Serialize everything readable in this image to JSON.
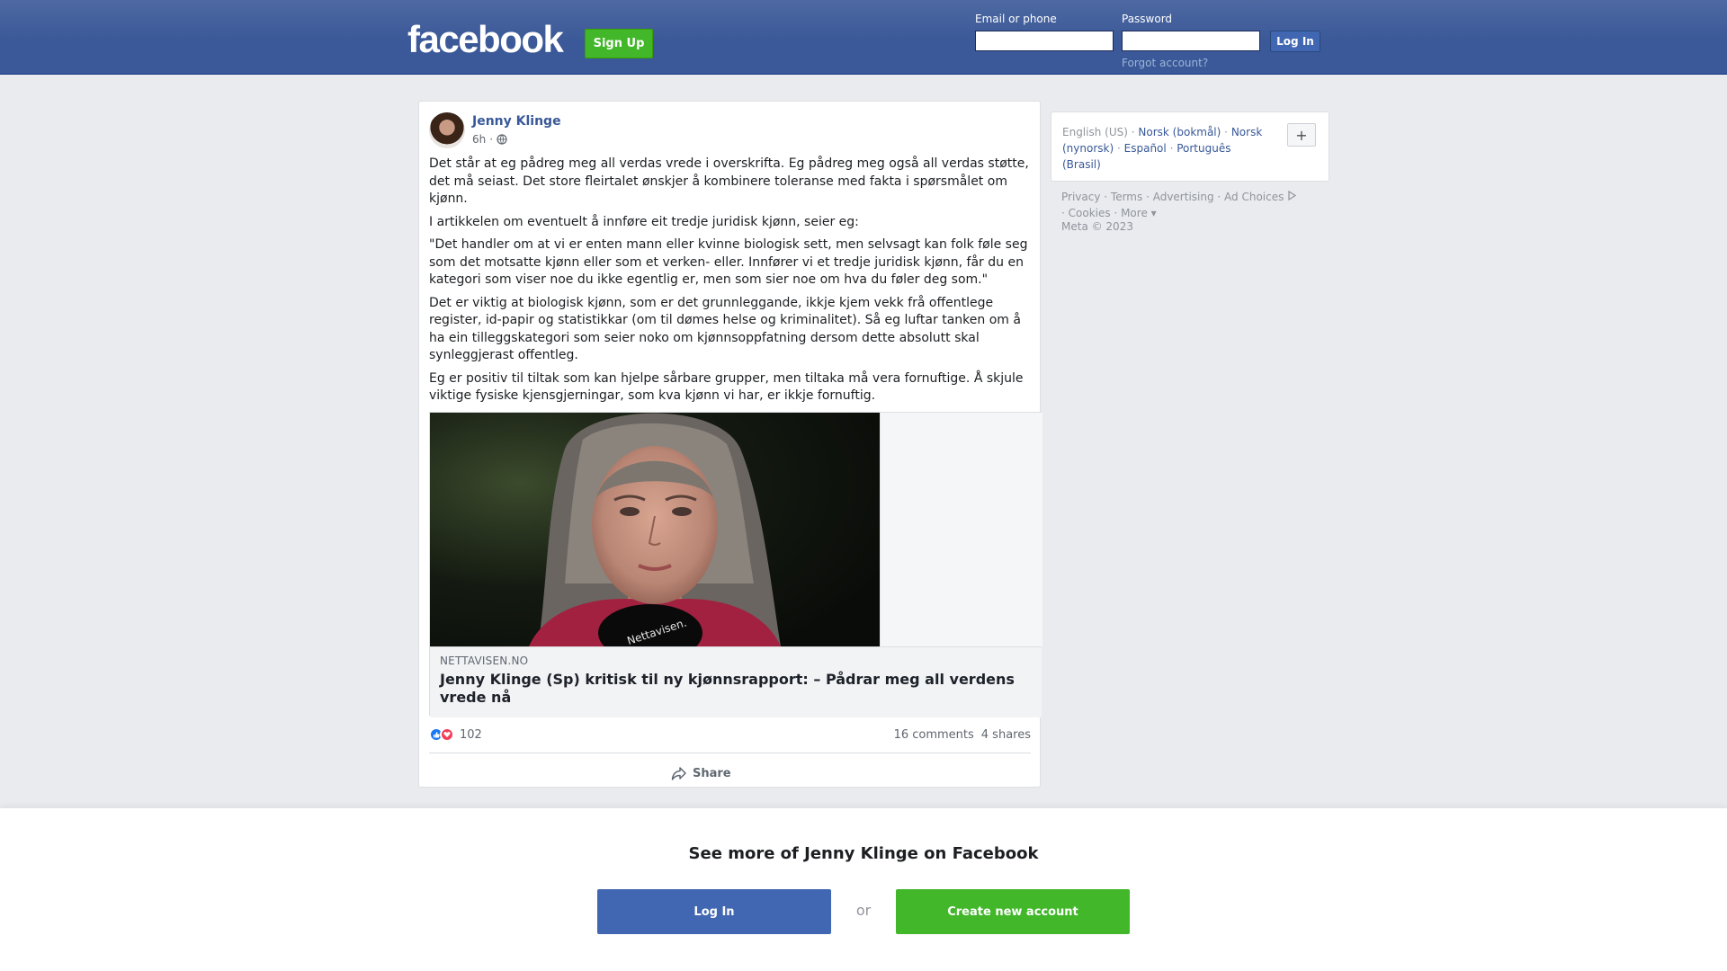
{
  "header": {
    "logo": "facebook",
    "signup_label": "Sign Up",
    "email_label": "Email or phone",
    "email_value": "",
    "password_label": "Password",
    "password_value": "",
    "login_label": "Log In",
    "forgot_label": "Forgot account?"
  },
  "post": {
    "author": "Jenny Klinge",
    "time": "6h",
    "time_separator": "·",
    "paragraphs": [
      "Det står at eg pådreg meg all verdas vrede i overskrifta. Eg pådreg meg også all verdas støtte, det må seiast. Det store fleirtalet ønskjer å kombinere toleranse med fakta i spørsmålet om kjønn.",
      "I artikkelen om eventuelt å innføre eit tredje juridisk kjønn, seier eg:",
      "\"Det handler om at vi er enten mann eller kvinne biologisk sett, men selvsagt kan folk føle seg som det motsatte kjønn eller som et verken- eller. Innfører vi et tredje juridisk kjønn, får du en kategori som viser noe du ikke egentlig er, men som sier noe om hva du føler deg som.\"",
      "Det er viktig at biologisk kjønn, som er det grunnleggande, ikkje kjem vekk frå offentlege register, id-papir og statistikkar (om til dømes helse og kriminalitet). Så eg luftar tanken om å ha ein tilleggskategori som seier noko om kjønnsoppfatning dersom dette absolutt skal synleggjerast offentleg.",
      "Eg er positiv til tiltak som kan hjelpe sårbare grupper, men tiltaka må vera fornuftige. Å skjule viktige fysiske kjensgjerningar, som kva kjønn vi har, er ikkje fornuftig."
    ],
    "link": {
      "source": "NETTAVISEN.NO",
      "headline": "Jenny Klinge (Sp) kritisk til ny kjønnsrapport: – Pådrar meg all verdens vrede nå",
      "mic_text": "Nettavisen."
    },
    "reactions_count": "102",
    "comments": "16 comments",
    "shares": "4 shares",
    "share_label": "Share"
  },
  "sidebar": {
    "languages": {
      "current": "English (US)",
      "others": [
        "Norsk (bokmål)",
        "Norsk (nynorsk)",
        "Español",
        "Português (Brasil)"
      ],
      "separator": "·"
    },
    "plus_label": "+",
    "footer_links": [
      "Privacy",
      "Terms",
      "Advertising",
      "Ad Choices",
      "Cookies",
      "More"
    ],
    "copyright": "Meta © 2023"
  },
  "bottom": {
    "title": "See more of Jenny Klinge on Facebook",
    "login_label": "Log In",
    "or_label": "or",
    "create_label": "Create new account"
  },
  "colors": {
    "brand_blue": "#3b5998",
    "button_blue": "#4267b2",
    "green": "#42b72a",
    "link": "#385898"
  }
}
